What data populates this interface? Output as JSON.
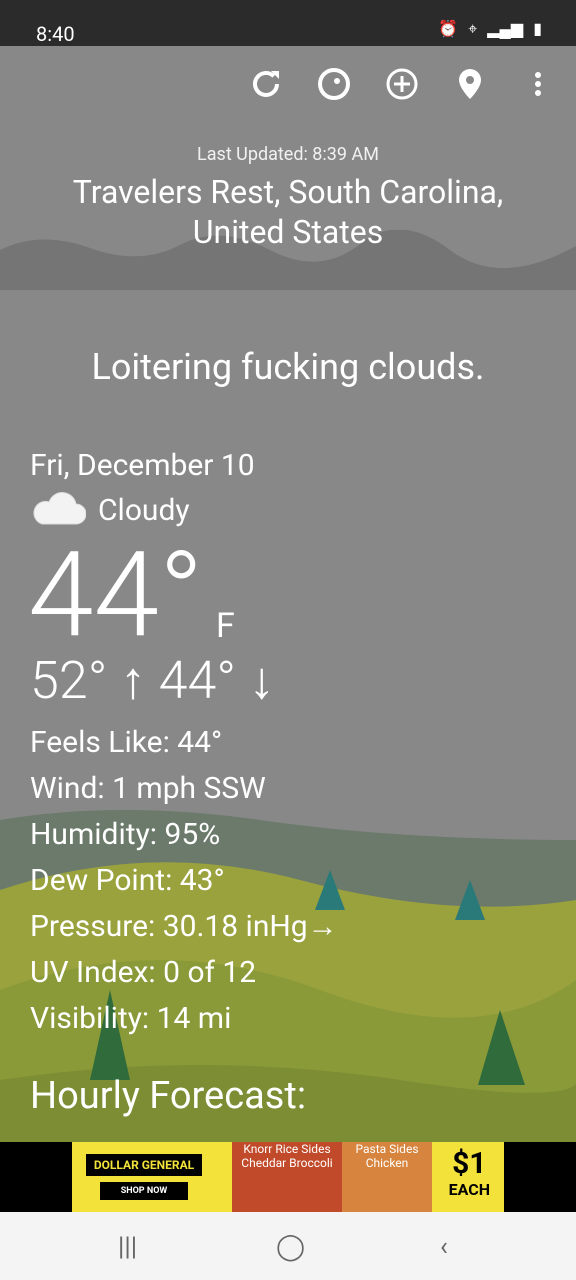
{
  "status_bar": {
    "time": "8:40",
    "icons": [
      "alarm-icon",
      "location-icon",
      "4g-icon",
      "signal-icon",
      "battery-icon"
    ]
  },
  "toolbar": {
    "icons": [
      "refresh-icon",
      "theme-icon",
      "add-location-icon",
      "location-pin-icon",
      "more-icon"
    ]
  },
  "header": {
    "last_updated": "Last Updated: 8:39 AM",
    "location": "Travelers Rest, South Carolina, United States"
  },
  "quote": "Loitering fucking clouds.",
  "weather": {
    "date": "Fri, December 10",
    "condition": "Cloudy",
    "temp": "44°",
    "unit": "F",
    "hilo": "52° ↑  44° ↓",
    "details": [
      "Feels Like:  44°",
      "Wind:  1 mph SSW",
      "Humidity:  95%",
      "Dew Point:  43°",
      "Pressure:  30.18 inHg→",
      "UV Index:  0 of 12",
      "Visibility:  14 mi"
    ]
  },
  "hourly_title": "Hourly Forecast:",
  "ad": {
    "store": "DOLLAR GENERAL",
    "cta": "SHOP NOW",
    "product1": "Knorr Rice Sides Cheddar Broccoli",
    "product2": "Pasta Sides Chicken",
    "price": "$1",
    "price_note": "EACH"
  },
  "colors": {
    "sky": "#888888",
    "hill": "#8a9a39",
    "ad_bg": "#f3e23a"
  }
}
